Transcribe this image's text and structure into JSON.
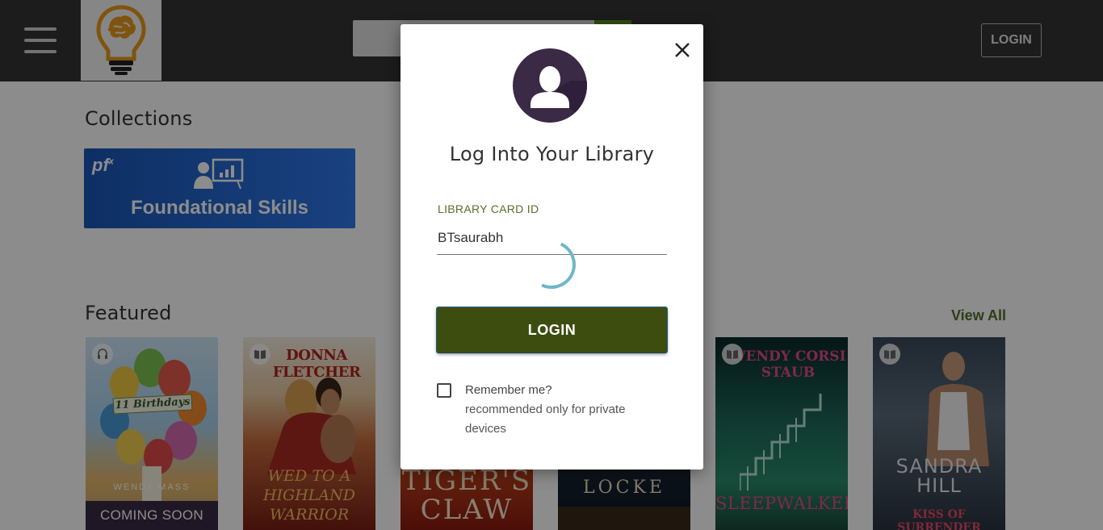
{
  "header": {
    "menu_icon": "hamburger-menu-icon",
    "logo_icon": "lightbulb-brain-icon",
    "search_icon": "search-icon",
    "login_label": "LOGIN"
  },
  "collections": {
    "title": "Collections",
    "items": [
      {
        "logo": "pf",
        "logo_sup": "x",
        "label": "Foundational Skills",
        "icon": "presentation-chart-icon"
      }
    ]
  },
  "featured": {
    "title": "Featured",
    "view_all": "View All",
    "books": [
      {
        "title_text": "11 Birthdays",
        "author_text": "WENDY MASS",
        "status": "COMING SOON",
        "format_icon": "headphones-icon"
      },
      {
        "title_text": "WED TO A HIGHLAND WARRIOR",
        "author_text": "DONNA FLETCHER",
        "format_icon": "book-icon"
      },
      {
        "title_text": "TIGER'S CLAW",
        "author_text": ""
      },
      {
        "title_text": "LOCKE",
        "author_text": ""
      },
      {
        "title_text": "SLEEPWALKER",
        "author_text": "WENDY CORSI STAUB",
        "format_icon": "book-icon"
      },
      {
        "title_text": "KISS OF SURRENDER",
        "author_text": "SANDRA HILL",
        "format_icon": "book-icon"
      }
    ]
  },
  "modal": {
    "avatar_icon": "user-avatar-icon",
    "close_icon": "close-icon",
    "title": "Log Into Your Library",
    "field_label": "LIBRARY CARD ID",
    "field_value": "BTsaurabh",
    "login_label": "LOGIN",
    "remember_label": "Remember me?",
    "remember_sub": "recommended only for private devices",
    "remember_checked": false
  },
  "colors": {
    "topbar": "#343434",
    "accent_green": "#55702a",
    "login_button": "#3c4d0f",
    "spinner": "#6fb6c8"
  }
}
